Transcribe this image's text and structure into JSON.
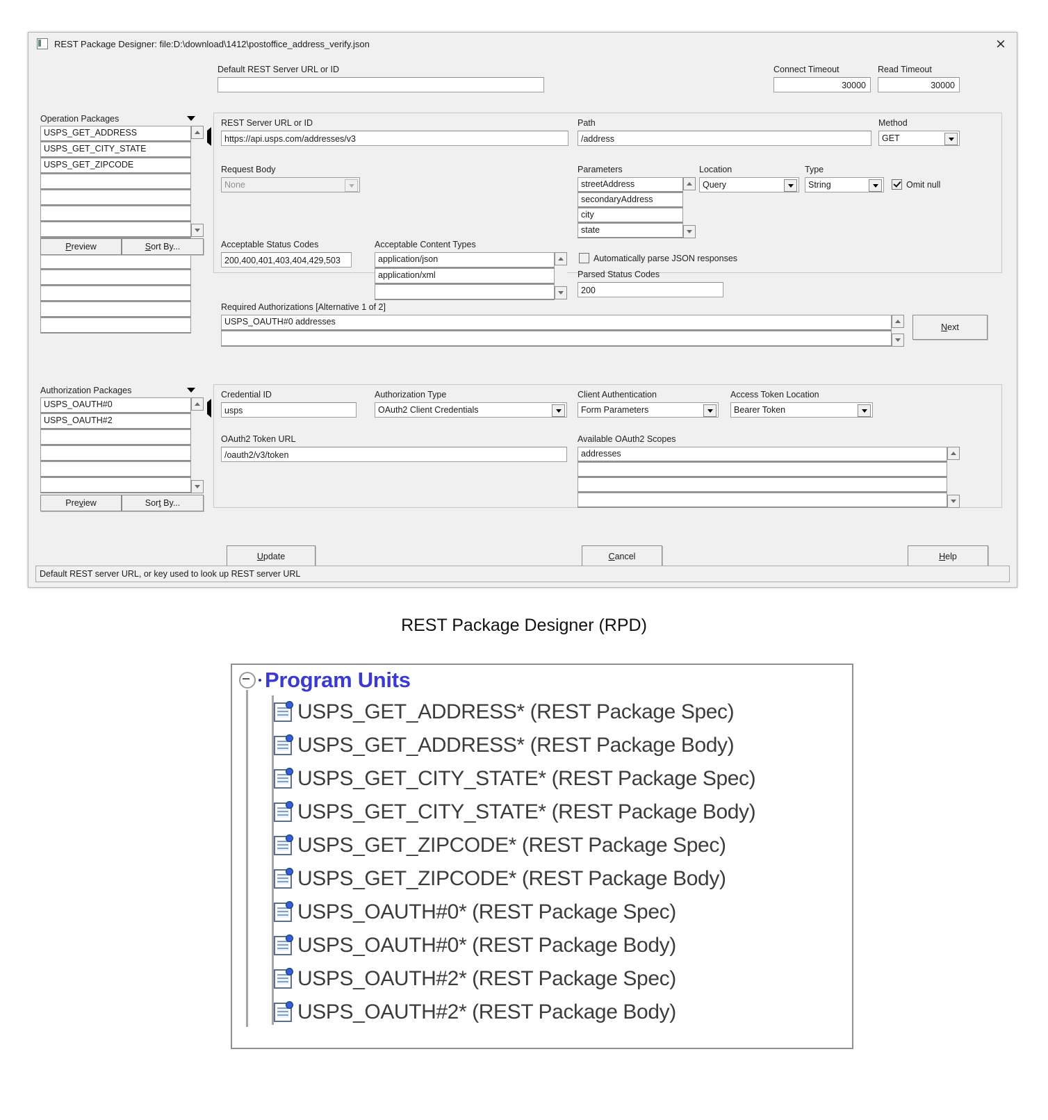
{
  "window": {
    "title": "REST Package Designer: file:D:\\download\\1412\\postoffice_address_verify.json",
    "close_label": "×"
  },
  "top": {
    "default_url_label": "Default REST Server URL or ID",
    "default_url_value": "",
    "connect_timeout_label": "Connect Timeout",
    "connect_timeout_value": "30000",
    "read_timeout_label": "Read Timeout",
    "read_timeout_value": "30000"
  },
  "operation_packages": {
    "label": "Operation Packages",
    "items": [
      "USPS_GET_ADDRESS",
      "USPS_GET_CITY_STATE",
      "USPS_GET_ZIPCODE"
    ],
    "empty_rows": 10,
    "preview_label": "Preview",
    "preview_mnemonic": "P",
    "sort_by_label": "Sort By...",
    "sort_by_mnemonic": "S"
  },
  "operation": {
    "server_url_label": "REST Server URL or ID",
    "server_url_value": "https://api.usps.com/addresses/v3",
    "path_label": "Path",
    "path_value": "/address",
    "method_label": "Method",
    "method_value": "GET",
    "request_body_label": "Request Body",
    "request_body_value": "None",
    "parameters_label": "Parameters",
    "parameters": [
      "streetAddress",
      "secondaryAddress",
      "city",
      "state"
    ],
    "location_label": "Location",
    "location_value": "Query",
    "type_label": "Type",
    "type_value": "String",
    "omit_null_label": "Omit null",
    "omit_null_checked": true,
    "status_codes_label": "Acceptable Status Codes",
    "status_codes_value": "200,400,401,403,404,429,503",
    "content_types_label": "Acceptable Content Types",
    "content_types": [
      "application/json",
      "application/xml",
      ""
    ],
    "auto_parse_label": "Automatically parse JSON responses",
    "auto_parse_checked": false,
    "parsed_status_label": "Parsed Status Codes",
    "parsed_status_value": "200",
    "required_auth_label": "Required Authorizations [Alternative 1 of 2]",
    "required_auth_rows": [
      "USPS_OAUTH#0 addresses",
      ""
    ],
    "next_label": "Next",
    "next_mnemonic": "N"
  },
  "authorization_packages": {
    "label": "Authorization Packages",
    "items": [
      "USPS_OAUTH#0",
      "USPS_OAUTH#2"
    ],
    "empty_rows": 4,
    "preview_label": "Preview",
    "preview_mnemonic": "v",
    "sort_by_label": "Sort By...",
    "sort_by_mnemonic": "t"
  },
  "authorization": {
    "credential_id_label": "Credential ID",
    "credential_id_value": "usps",
    "auth_type_label": "Authorization Type",
    "auth_type_value": "OAuth2 Client Credentials",
    "client_auth_label": "Client Authentication",
    "client_auth_value": "Form Parameters",
    "token_location_label": "Access Token Location",
    "token_location_value": "Bearer Token",
    "token_url_label": "OAuth2 Token URL",
    "token_url_value": "/oauth2/v3/token",
    "scopes_label": "Available OAuth2 Scopes",
    "scopes": [
      "addresses",
      "",
      "",
      ""
    ]
  },
  "footer": {
    "update_label": "Update",
    "update_mnemonic": "U",
    "cancel_label": "Cancel",
    "cancel_mnemonic": "C",
    "help_label": "Help",
    "help_mnemonic": "H",
    "status_text": "Default REST server URL, or key used to look up REST server URL"
  },
  "caption": "REST Package Designer (RPD)",
  "tree": {
    "root_label": "Program Units",
    "items": [
      "USPS_GET_ADDRESS* (REST Package Spec)",
      "USPS_GET_ADDRESS* (REST Package Body)",
      "USPS_GET_CITY_STATE* (REST Package Spec)",
      "USPS_GET_CITY_STATE* (REST Package Body)",
      "USPS_GET_ZIPCODE* (REST Package Spec)",
      "USPS_GET_ZIPCODE* (REST Package Body)",
      "USPS_OAUTH#0* (REST Package Spec)",
      "USPS_OAUTH#0* (REST Package Body)",
      "USPS_OAUTH#2* (REST Package Spec)",
      "USPS_OAUTH#2* (REST Package Body)"
    ]
  },
  "colors": {
    "window_bg": "#f0f0f0",
    "field_bg": "#ffffff",
    "tree_root_text": "#3a3ad0",
    "tree_item_text": "#3c3c3c"
  }
}
